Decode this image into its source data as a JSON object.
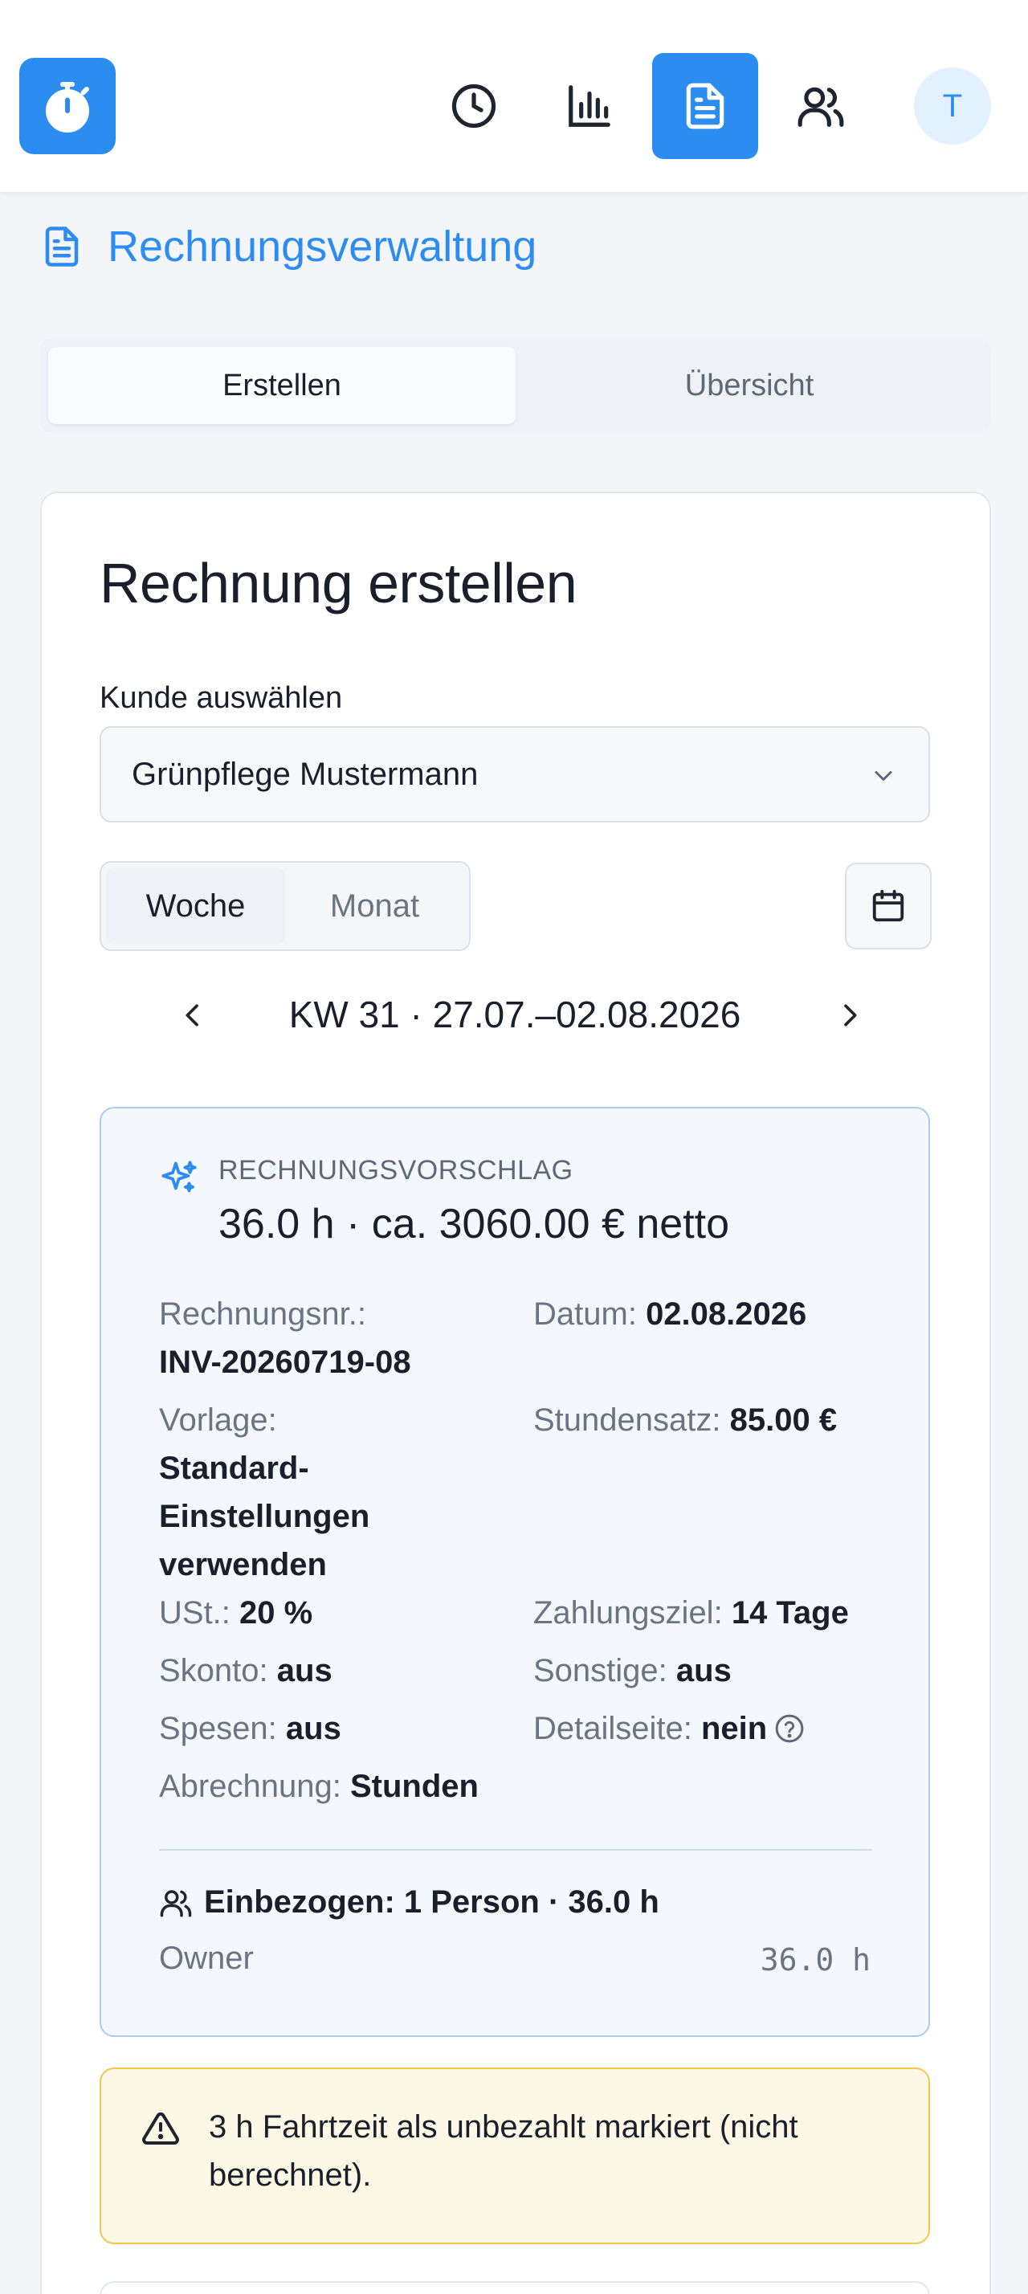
{
  "header": {
    "logo_icon": "stopwatch-icon",
    "nav": [
      {
        "icon": "clock-icon"
      },
      {
        "icon": "bar-chart-icon"
      },
      {
        "icon": "document-icon",
        "active": true
      },
      {
        "icon": "users-icon"
      }
    ],
    "avatar_initial": "T"
  },
  "page": {
    "title": "Rechnungsverwaltung",
    "title_icon": "document-icon"
  },
  "tabs": [
    {
      "label": "Erstellen",
      "active": true
    },
    {
      "label": "Übersicht",
      "active": false
    }
  ],
  "card": {
    "title": "Rechnung erstellen",
    "customer_label": "Kunde auswählen",
    "customer_value": "Grünpflege Mustermann",
    "period_options": [
      "Woche",
      "Monat"
    ],
    "period_selected": "Woche",
    "week_label": "KW 31 · 27.07.–02.08.2026"
  },
  "suggestion": {
    "kicker": "RECHNUNGSVORSCHLAG",
    "summary": "36.0 h · ca. 3060.00 € netto",
    "invoice_no_label": "Rechnungsnr.:",
    "invoice_no": "INV-20260719-08",
    "date_label": "Datum:",
    "date": "02.08.2026",
    "template_label": "Vorlage:",
    "template_line1": "Standard-",
    "template_line2": "Einstellungen",
    "template_line3": "verwenden",
    "rate_label": "Stundensatz:",
    "rate": "85.00 €",
    "vat_label": "USt.:",
    "vat": "20 %",
    "payment_label": "Zahlungsziel:",
    "payment": "14 Tage",
    "discount_label": "Skonto:",
    "discount": "aus",
    "other_label": "Sonstige:",
    "other": "aus",
    "expenses_label": "Spesen:",
    "expenses": "aus",
    "detail_label": "Detailseite:",
    "detail": "nein",
    "billing_label": "Abrechnung:",
    "billing": "Stunden",
    "included": "Einbezogen: 1 Person · 36.0 h",
    "person_name": "Owner",
    "person_hours": "36.0 h"
  },
  "warning": {
    "text": "3 h Fahrtzeit als unbezahlt markiert (nicht berechnet)."
  },
  "colors": {
    "accent": "#2d8cf0",
    "warning_bg": "#fdf8e6",
    "warning_border": "#f1c84d",
    "suggest_bg": "#f4f8fc",
    "suggest_border": "#a9ccf0"
  }
}
